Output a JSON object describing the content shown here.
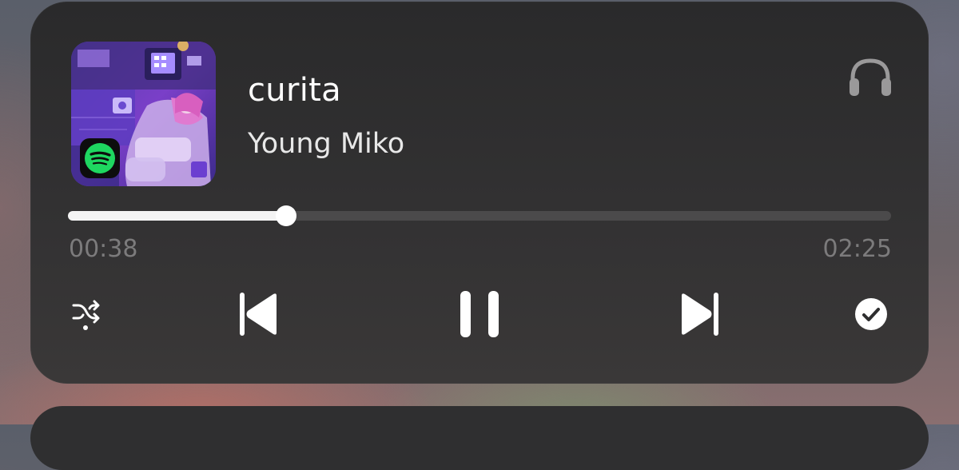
{
  "track": {
    "title": "curita",
    "artist": "Young Miko"
  },
  "playback": {
    "elapsed": "00:38",
    "total": "02:25",
    "progress_fraction": 0.265,
    "state": "playing"
  },
  "icons": {
    "source_app": "spotify-icon",
    "output_device": "headphones-icon",
    "shuffle": "shuffle-icon",
    "previous": "previous-icon",
    "pause": "pause-icon",
    "next": "next-icon",
    "liked": "check-circle-icon"
  },
  "colors": {
    "card": "#2e2e2f",
    "text_primary": "#ffffff",
    "text_secondary": "#7c7b7c",
    "progress_fill": "#f4f4f4",
    "progress_track": "#4b4a4b",
    "spotify_green": "#1ed760"
  }
}
